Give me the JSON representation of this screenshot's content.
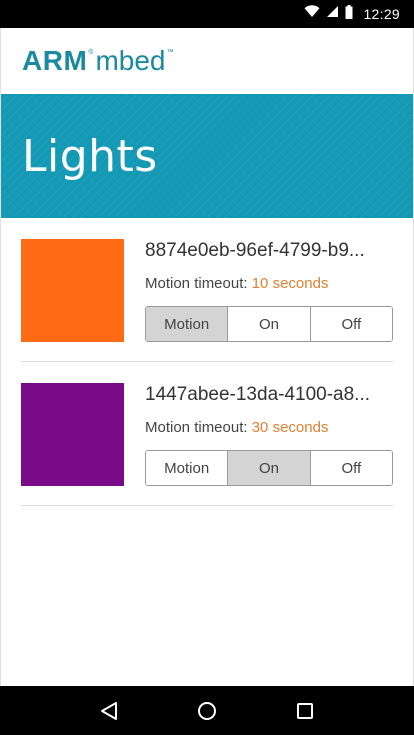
{
  "status_bar": {
    "time": "12:29",
    "icons": [
      "wifi-icon",
      "signal-icon",
      "battery-icon"
    ]
  },
  "brand": {
    "arm": "ARM",
    "mbed": "mbed",
    "reg": "®",
    "tm": "™"
  },
  "header": {
    "title": "Lights"
  },
  "lights": [
    {
      "id": "8874e0eb-96ef-4799-b9...",
      "color": "#ff6a13",
      "timeout_label": "Motion timeout: ",
      "timeout_value": "10 seconds",
      "modes": [
        "Motion",
        "On",
        "Off"
      ],
      "active_mode": "Motion"
    },
    {
      "id": "1447abee-13da-4100-a8...",
      "color": "#7a0a87",
      "timeout_label": "Motion timeout: ",
      "timeout_value": "30 seconds",
      "modes": [
        "Motion",
        "On",
        "Off"
      ],
      "active_mode": "On"
    }
  ],
  "nav": {
    "icons": [
      "back-icon",
      "home-icon",
      "recents-icon"
    ]
  },
  "colors": {
    "brand": "#1b8aa1",
    "hero": "#1499b5",
    "timeout_accent": "#e08030"
  }
}
